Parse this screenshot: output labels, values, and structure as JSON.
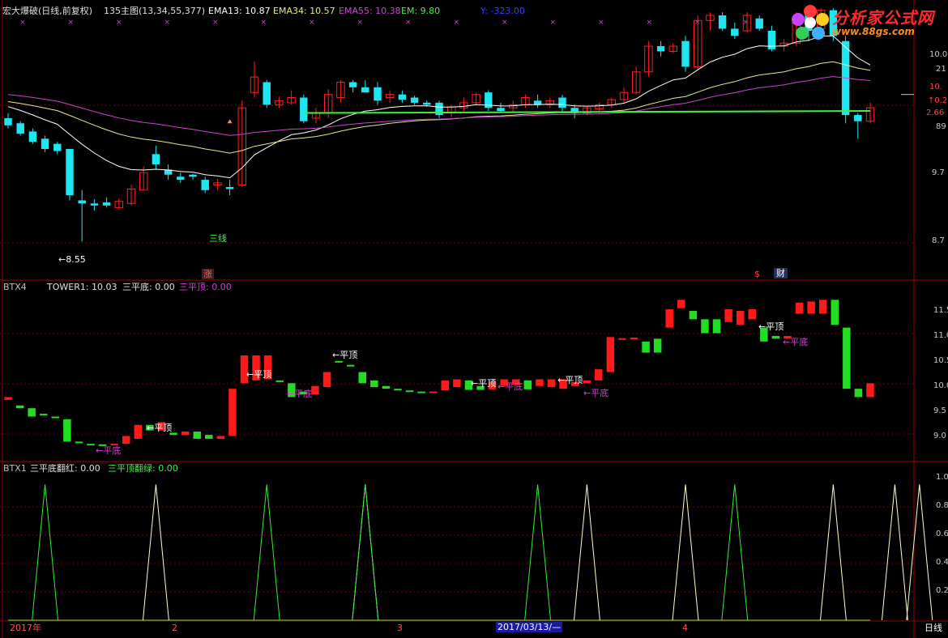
{
  "header": {
    "title": "宏大爆破(日线,前复权)",
    "main_params": "135主图(13,34,55,377)",
    "ema13": "EMA13: 10.87",
    "ema34": "EMA34: 10.57",
    "ema55": "EMA55: 10.38",
    "em": "EM: 9.80",
    "ylabel": "Y: -323.00"
  },
  "logo": {
    "title": "分析家公式网",
    "url": "www.88gs.com"
  },
  "main_panel": {
    "price_axis": [
      "10.0",
      "21",
      "10.",
      "↑0.2",
      "2.66",
      "89",
      "9.7",
      "8.7"
    ],
    "annotations": {
      "low": "←8.55",
      "sanxian": "三线",
      "zhang": "涨",
      "money": "$",
      "cai": "财"
    }
  },
  "btx4_panel": {
    "name": "BTX4",
    "tower": "TOWER1: 10.03",
    "spd": "三平底: 0.00",
    "spt": "三平顶: 0.00",
    "axis": [
      "11.5",
      "11.0",
      "10.5",
      "10.0",
      "9.5",
      "9.0"
    ],
    "ping_ding": "←平顶",
    "ping_di": "←平底"
  },
  "btx1_panel": {
    "name": "BTX1",
    "red": "三平底翻红: 0.00",
    "green": "三平顶翻绿: 0.00",
    "axis": [
      "1.0",
      "0.8",
      "0.6",
      "0.4",
      "0.2"
    ]
  },
  "date_axis": {
    "labels": [
      "2017年",
      "2",
      "3",
      "2017/03/13/—",
      "4"
    ],
    "period": "日线"
  },
  "colors": {
    "up": "#ff2020",
    "down": "#1fe5f2",
    "tower_up": "#ff1a1a",
    "tower_down": "#22dd22",
    "ema13": "#ffffff",
    "ema34": "#e8e890",
    "ema55": "#cc44cc",
    "em": "#44ee44",
    "grid": "#800000"
  },
  "chart_data": [
    {
      "type": "candlestick",
      "title": "宏大爆破(日线,前复权)",
      "ylim": [
        8.3,
        10.6
      ],
      "candles": [
        [
          9.75,
          9.8,
          9.68,
          9.65
        ],
        [
          9.7,
          9.72,
          9.6,
          9.58
        ],
        [
          9.62,
          9.65,
          9.52,
          9.5
        ],
        [
          9.55,
          9.58,
          9.45,
          9.42
        ],
        [
          9.5,
          9.52,
          9.43,
          9.4
        ],
        [
          9.45,
          9.45,
          9.0,
          8.95
        ],
        [
          8.95,
          9.05,
          8.92,
          8.55
        ],
        [
          8.92,
          8.96,
          8.9,
          8.85
        ],
        [
          8.93,
          8.98,
          8.9,
          8.88
        ],
        [
          8.88,
          8.97,
          8.94,
          8.86
        ],
        [
          8.92,
          9.1,
          9.06,
          8.9
        ],
        [
          9.05,
          9.28,
          9.22,
          9.05
        ],
        [
          9.4,
          9.48,
          9.3,
          9.25
        ],
        [
          9.25,
          9.3,
          9.2,
          9.15
        ],
        [
          9.18,
          9.22,
          9.15,
          9.12
        ],
        [
          9.2,
          9.21,
          9.18,
          9.15
        ],
        [
          9.15,
          9.18,
          9.05,
          9.02
        ],
        [
          9.1,
          9.16,
          9.12,
          9.05
        ],
        [
          9.08,
          9.15,
          9.06,
          9.0
        ],
        [
          9.1,
          9.92,
          9.85,
          9.08
        ],
        [
          10.0,
          10.3,
          10.15,
          9.95
        ],
        [
          10.1,
          10.12,
          9.88,
          9.85
        ],
        [
          9.88,
          9.96,
          9.92,
          9.85
        ],
        [
          9.9,
          10.02,
          9.95,
          9.88
        ],
        [
          9.95,
          9.98,
          9.72,
          9.7
        ],
        [
          9.75,
          9.85,
          9.8,
          9.7
        ],
        [
          9.8,
          10.03,
          9.98,
          9.75
        ],
        [
          9.95,
          10.12,
          10.1,
          9.9
        ],
        [
          10.1,
          10.12,
          10.05,
          10.0
        ],
        [
          10.05,
          10.12,
          10.0,
          10.0
        ],
        [
          10.05,
          10.1,
          9.92,
          9.88
        ],
        [
          9.95,
          10.02,
          9.98,
          9.9
        ],
        [
          9.98,
          10.02,
          9.93,
          9.9
        ],
        [
          9.95,
          9.97,
          9.9,
          9.88
        ],
        [
          9.9,
          9.92,
          9.88,
          9.86
        ],
        [
          9.9,
          9.92,
          9.78,
          9.75
        ],
        [
          9.8,
          9.88,
          9.86,
          9.76
        ],
        [
          9.85,
          9.95,
          9.9,
          9.82
        ],
        [
          9.9,
          10.0,
          9.98,
          9.88
        ],
        [
          10.0,
          10.02,
          9.85,
          9.82
        ],
        [
          9.85,
          9.9,
          9.82,
          9.8
        ],
        [
          9.85,
          9.92,
          9.88,
          9.8
        ],
        [
          9.88,
          9.98,
          9.95,
          9.85
        ],
        [
          9.92,
          9.98,
          9.88,
          9.85
        ],
        [
          9.88,
          9.95,
          9.92,
          9.85
        ],
        [
          9.95,
          9.98,
          9.85,
          9.8
        ],
        [
          9.85,
          9.88,
          9.8,
          9.75
        ],
        [
          9.8,
          9.86,
          9.85,
          9.78
        ],
        [
          9.84,
          9.9,
          9.88,
          9.8
        ],
        [
          9.88,
          9.95,
          9.93,
          9.85
        ],
        [
          9.93,
          10.05,
          10.0,
          9.9
        ],
        [
          10.0,
          10.25,
          10.2,
          9.98
        ],
        [
          10.2,
          10.5,
          10.45,
          10.15
        ],
        [
          10.45,
          10.5,
          10.4,
          10.35
        ],
        [
          10.4,
          10.48,
          10.45,
          10.38
        ],
        [
          10.5,
          10.55,
          10.25,
          10.2
        ],
        [
          10.25,
          10.75,
          10.7,
          10.22
        ],
        [
          10.7,
          10.78,
          10.75,
          10.6
        ],
        [
          10.75,
          10.78,
          10.62,
          10.6
        ],
        [
          10.62,
          10.68,
          10.55,
          10.52
        ],
        [
          10.6,
          10.78,
          10.75,
          10.58
        ],
        [
          10.72,
          10.75,
          10.62,
          10.6
        ],
        [
          10.6,
          10.65,
          10.42,
          10.4
        ],
        [
          10.45,
          10.52,
          10.48,
          10.4
        ],
        [
          10.48,
          10.78,
          10.72,
          10.45
        ],
        [
          10.75,
          10.78,
          10.6,
          10.5
        ],
        [
          10.62,
          10.82,
          10.8,
          10.6
        ],
        [
          10.8,
          10.82,
          10.55,
          10.5
        ],
        [
          10.5,
          10.55,
          9.78,
          9.7
        ],
        [
          9.78,
          9.8,
          9.72,
          9.55
        ],
        [
          9.72,
          9.9,
          9.85,
          9.7
        ]
      ],
      "series": [
        {
          "name": "EMA13"
        },
        {
          "name": "EMA34"
        },
        {
          "name": "EMA55"
        },
        {
          "name": "EM"
        }
      ]
    },
    {
      "type": "bar",
      "title": "BTX4",
      "ylim": [
        8.7,
        11.7
      ],
      "values": [
        [
          9.75,
          9.8,
          1
        ],
        [
          9.65,
          9.6,
          0
        ],
        [
          9.6,
          9.45,
          0
        ],
        [
          9.5,
          9.48,
          0
        ],
        [
          9.45,
          9.43,
          0
        ],
        [
          9.4,
          9.0,
          0
        ],
        [
          9.0,
          8.98,
          0
        ],
        [
          8.96,
          8.95,
          0
        ],
        [
          8.95,
          8.94,
          0
        ],
        [
          8.94,
          8.96,
          1
        ],
        [
          8.96,
          9.1,
          1
        ],
        [
          9.05,
          9.3,
          1
        ],
        [
          9.3,
          9.2,
          0
        ],
        [
          9.2,
          9.35,
          1
        ],
        [
          9.16,
          9.12,
          0
        ],
        [
          9.12,
          9.18,
          1
        ],
        [
          9.18,
          9.05,
          0
        ],
        [
          9.12,
          9.05,
          0
        ],
        [
          9.05,
          9.1,
          1
        ],
        [
          9.1,
          9.95,
          1
        ],
        [
          10.05,
          10.55,
          1
        ],
        [
          10.1,
          10.55,
          1
        ],
        [
          10.12,
          10.55,
          1
        ],
        [
          10.1,
          10.08,
          0
        ],
        [
          10.05,
          9.8,
          0
        ],
        [
          9.9,
          9.85,
          0
        ],
        [
          9.85,
          10.0,
          1
        ],
        [
          9.98,
          10.25,
          1
        ],
        [
          10.45,
          10.44,
          0
        ],
        [
          10.38,
          10.35,
          0
        ],
        [
          10.25,
          10.05,
          0
        ],
        [
          10.1,
          9.98,
          0
        ],
        [
          10.0,
          9.95,
          0
        ],
        [
          9.95,
          9.92,
          0
        ],
        [
          9.92,
          9.9,
          0
        ],
        [
          9.9,
          9.88,
          0
        ],
        [
          9.9,
          9.9,
          1
        ],
        [
          9.92,
          10.1,
          1
        ],
        [
          9.98,
          10.12,
          1
        ],
        [
          10.1,
          9.93,
          0
        ],
        [
          10.0,
          9.93,
          0
        ],
        [
          9.94,
          10.08,
          1
        ],
        [
          10.0,
          10.12,
          1
        ],
        [
          10.02,
          10.12,
          1
        ],
        [
          10.1,
          9.94,
          0
        ],
        [
          10.0,
          10.12,
          1
        ],
        [
          9.98,
          10.12,
          1
        ],
        [
          9.95,
          10.12,
          1
        ],
        [
          10.0,
          10.07,
          1
        ],
        [
          10.05,
          10.1,
          1
        ],
        [
          10.1,
          10.3,
          1
        ],
        [
          10.25,
          10.88,
          1
        ],
        [
          10.85,
          10.86,
          1
        ],
        [
          10.85,
          10.87,
          1
        ],
        [
          10.8,
          10.6,
          0
        ],
        [
          10.85,
          10.6,
          0
        ],
        [
          11.05,
          11.38,
          1
        ],
        [
          11.4,
          11.55,
          1
        ],
        [
          11.2,
          11.35,
          0
        ],
        [
          10.95,
          11.2,
          0
        ],
        [
          11.2,
          10.95,
          0
        ],
        [
          11.15,
          11.38,
          1
        ],
        [
          11.1,
          11.35,
          1
        ],
        [
          11.2,
          11.38,
          1
        ],
        [
          11.05,
          10.8,
          0
        ],
        [
          10.9,
          10.85,
          0
        ],
        [
          10.85,
          10.9,
          1
        ],
        [
          11.3,
          11.5,
          1
        ],
        [
          11.3,
          11.52,
          1
        ],
        [
          11.3,
          11.55,
          1
        ],
        [
          11.55,
          11.1,
          0
        ],
        [
          11.05,
          9.95,
          0
        ],
        [
          9.95,
          9.8,
          0
        ],
        [
          9.8,
          10.05,
          1
        ]
      ]
    },
    {
      "type": "line",
      "title": "BTX1",
      "ylim": [
        0,
        1.05
      ],
      "series": [
        {
          "name": "三平底翻红",
          "x": [
            12,
            29,
            47,
            55,
            67,
            72,
            74,
            80
          ],
          "y": [
            1,
            1,
            1,
            1,
            1,
            1,
            1,
            1
          ]
        },
        {
          "name": "三平顶翻绿",
          "x": [
            3,
            21,
            29,
            43,
            59
          ],
          "y": [
            1,
            1,
            1,
            1,
            1
          ]
        }
      ]
    }
  ]
}
